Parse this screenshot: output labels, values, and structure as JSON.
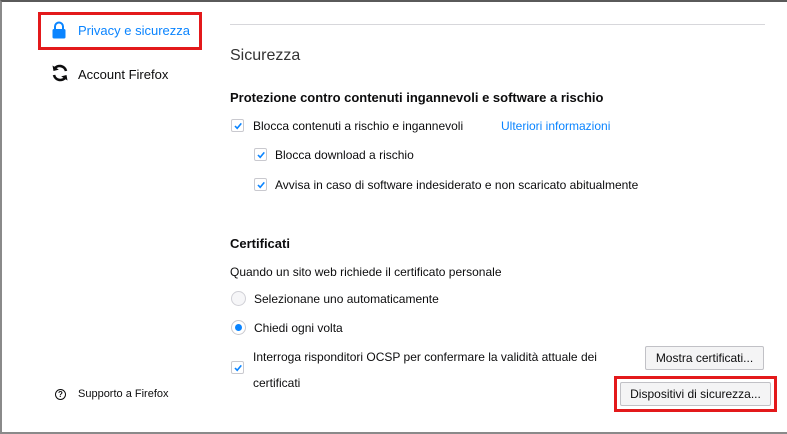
{
  "sidebar": {
    "items": [
      {
        "label": "Privacy e sicurezza",
        "icon": "lock-icon",
        "selected": true
      },
      {
        "label": "Account Firefox",
        "icon": "sync-icon",
        "selected": false
      }
    ],
    "support_label": "Supporto a Firefox",
    "support_icon": "help-icon"
  },
  "main": {
    "section_title": "Sicurezza",
    "phishing": {
      "heading": "Protezione contro contenuti ingannevoli e software a rischio",
      "block_dangerous": {
        "label": "Blocca contenuti a rischio e ingannevoli",
        "checked": true
      },
      "learn_more": "Ulteriori informazioni",
      "block_downloads": {
        "label": "Blocca download a rischio",
        "checked": true
      },
      "warn_unwanted": {
        "label": "Avvisa in caso di software indesiderato e non scaricato abitualmente",
        "checked": true
      }
    },
    "certificates": {
      "heading": "Certificati",
      "description": "Quando un sito web richiede il certificato personale",
      "options": [
        {
          "label": "Selezionane uno automaticamente",
          "checked": false
        },
        {
          "label": "Chiedi ogni volta",
          "checked": true
        }
      ],
      "ocsp": {
        "label_line1": "Interroga risponditori OCSP per confermare la validità attuale dei",
        "label_line2": "certificati",
        "checked": true
      },
      "view_certs_button": "Mostra certificati...",
      "security_devices_button": "Dispositivi di sicurezza..."
    }
  },
  "colors": {
    "accent": "#0a84ff",
    "highlight": "#e3191b"
  }
}
